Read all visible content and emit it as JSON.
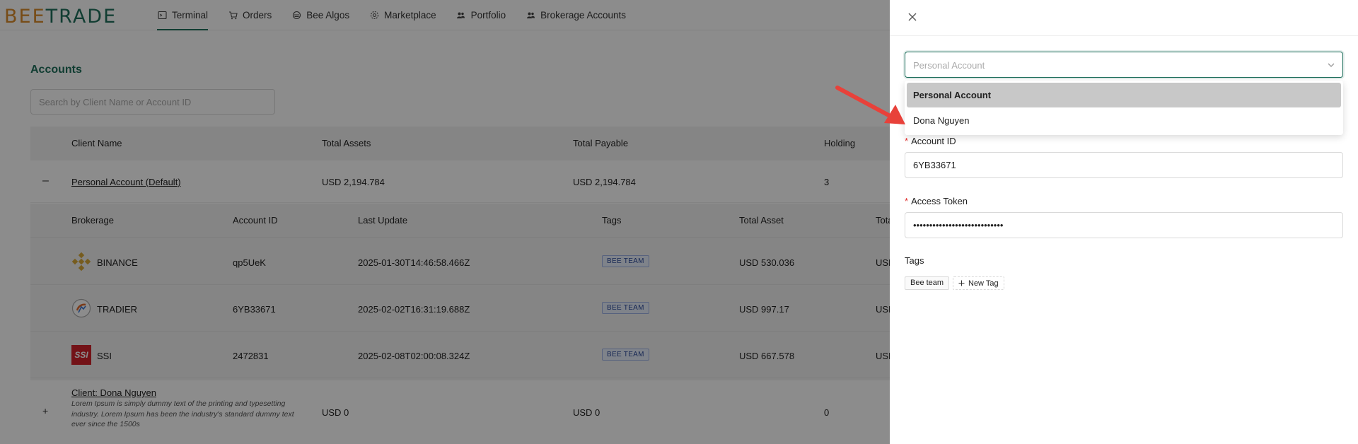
{
  "app": {
    "logo_part1": "BEE",
    "logo_part2": "TRADE"
  },
  "nav": {
    "items": [
      {
        "label": "Terminal",
        "icon": "terminal-icon"
      },
      {
        "label": "Orders",
        "icon": "cart-icon"
      },
      {
        "label": "Bee Algos",
        "icon": "bee-icon"
      },
      {
        "label": "Marketplace",
        "icon": "gear-icon"
      },
      {
        "label": "Portfolio",
        "icon": "people-icon"
      },
      {
        "label": "Brokerage Accounts",
        "icon": "people-icon"
      }
    ],
    "active_index": 0
  },
  "page": {
    "title": "Accounts",
    "search_placeholder": "Search by Client Name or Account ID"
  },
  "table": {
    "headers": [
      "Client Name",
      "Total Assets",
      "Total Payable",
      "Holding"
    ],
    "personal": {
      "toggle": "–",
      "name": "Personal Account (Default)",
      "total_assets": "USD 2,194.784",
      "total_payable": "USD 2,194.784",
      "holding": "3"
    },
    "sub_headers": [
      "Brokerage",
      "Account ID",
      "Last Update",
      "Tags",
      "Total Asset",
      "Tota"
    ],
    "sub_rows": [
      {
        "broker": "BINANCE",
        "account_id": "qp5UeK",
        "last_update": "2025-01-30T14:46:58.466Z",
        "tag": "BEE TEAM",
        "total_asset": "USD 530.036",
        "total_trunc": "USD",
        "icon": "binance-icon"
      },
      {
        "broker": "TRADIER",
        "account_id": "6YB33671",
        "last_update": "2025-02-02T16:31:19.688Z",
        "tag": "BEE TEAM",
        "total_asset": "USD 997.17",
        "total_trunc": "USD",
        "icon": "tradier-icon"
      },
      {
        "broker": "SSI",
        "account_id": "2472831",
        "last_update": "2025-02-08T02:00:08.324Z",
        "tag": "BEE TEAM",
        "total_asset": "USD 667.578",
        "total_trunc": "USD",
        "icon": "ssi-icon",
        "logo_text": "SSI"
      }
    ],
    "client": {
      "toggle": "+",
      "name": "Client: Dona Nguyen",
      "description": "Lorem Ipsum is simply dummy text of the printing and typesetting industry. Lorem Ipsum has been the industry's standard dummy text ever since the 1500s",
      "total_assets": "USD 0",
      "total_payable": "USD 0",
      "holding": "0"
    }
  },
  "drawer": {
    "select_placeholder": "Personal Account",
    "options": [
      "Personal Account",
      "Dona Nguyen"
    ],
    "account_id_label": "Account ID",
    "account_id_value": "6YB33671",
    "access_token_label": "Access Token",
    "access_token_value": "••••••••••••••••••••••••••••",
    "tags_label": "Tags",
    "tags": [
      "Bee team"
    ],
    "new_tag_label": "New Tag"
  },
  "colors": {
    "brand_green": "#1f6f5c",
    "brand_orange": "#d98a2b",
    "required": "#e0302f",
    "arrow": "#e8413a"
  }
}
